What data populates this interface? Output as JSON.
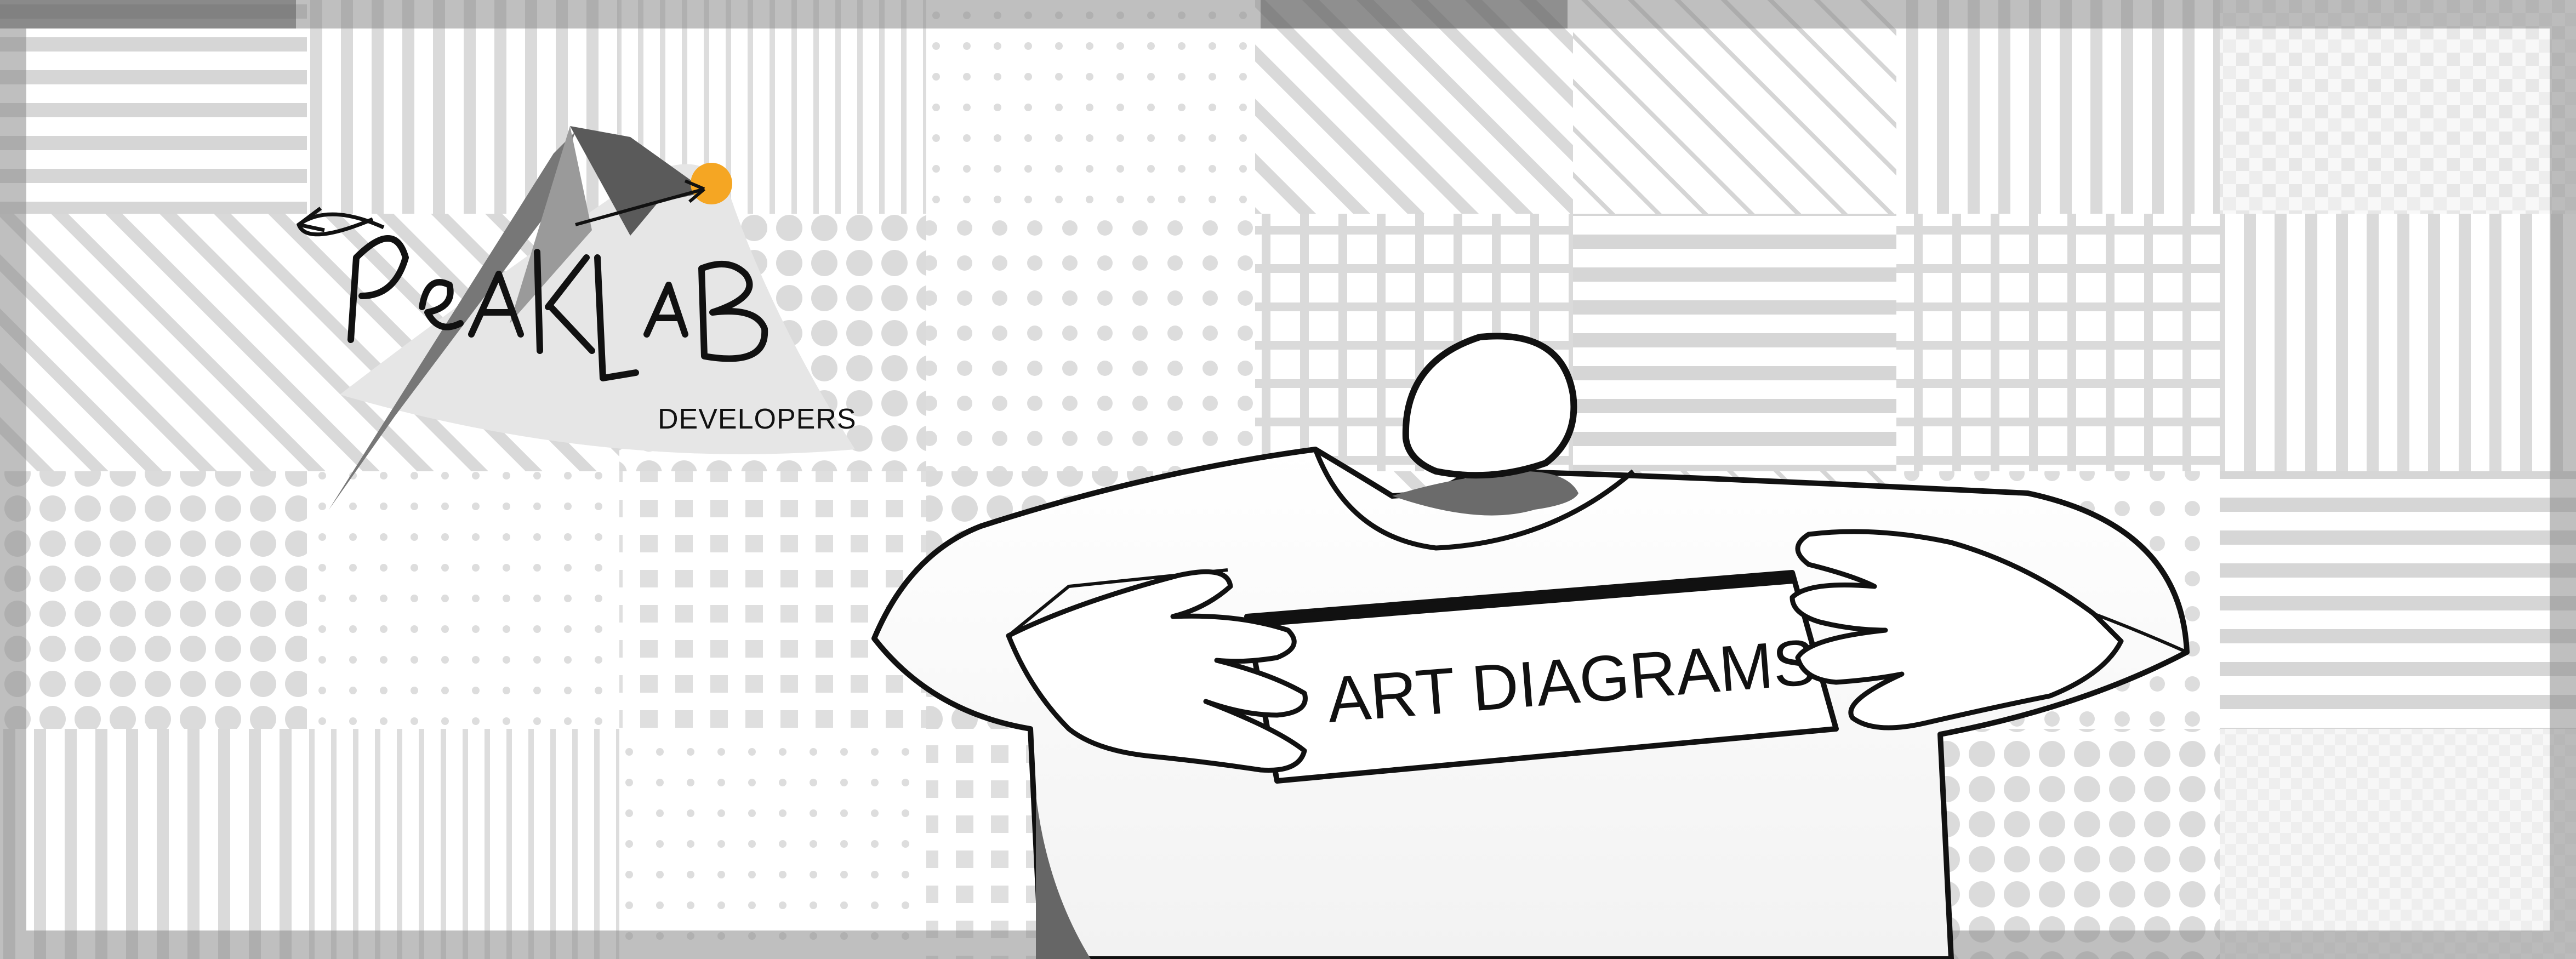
{
  "logo": {
    "wordmark": "PeakLab",
    "tagline": "DEVELOPERS",
    "accent_color": "#f5a623",
    "icon": "mountain-peak-arrow-icon"
  },
  "sign": {
    "label": "ART DIAGRAMS"
  },
  "palette": {
    "tile_gray": "#b5b5b5",
    "dark_gray": "#666666",
    "frame_gray": "#8a8a8a",
    "ink": "#111111"
  }
}
